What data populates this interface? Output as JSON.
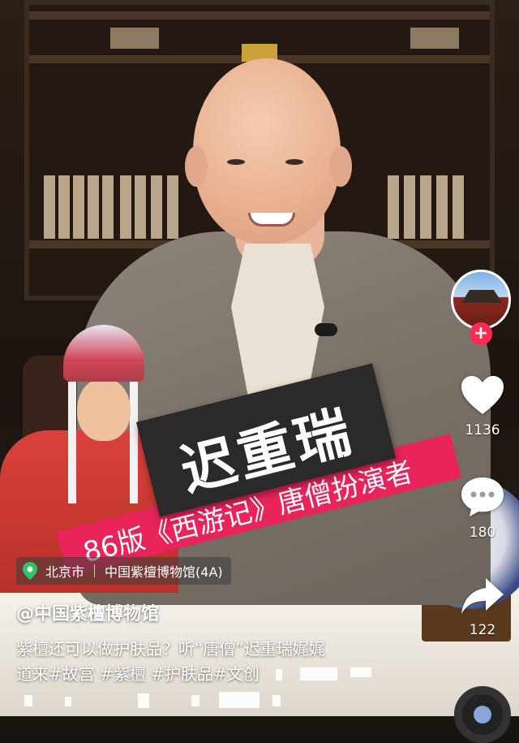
{
  "overlay": {
    "name": "迟重瑞",
    "role": "86版《西游记》唐僧扮演者"
  },
  "sidebar": {
    "likes": "1136",
    "comments": "180",
    "shares": "122",
    "follow_symbol": "+"
  },
  "location": {
    "city": "北京市",
    "place": "中国紫檀博物馆(4A)"
  },
  "post": {
    "author": "@中国紫檀博物馆",
    "caption_line1": "紫檀还可以做护肤品？听“唐僧”迟重瑞娓娓",
    "caption_line2": "道来#故宫 #紫檀 #护肤品#文创"
  },
  "colors": {
    "accent_pink": "#fe2c55",
    "role_band": "#e8245a",
    "name_card": "#2b2929",
    "location_pin": "#2fc26a"
  },
  "icons": [
    "heart-icon",
    "comment-icon",
    "share-icon",
    "location-pin-icon",
    "plus-icon"
  ]
}
